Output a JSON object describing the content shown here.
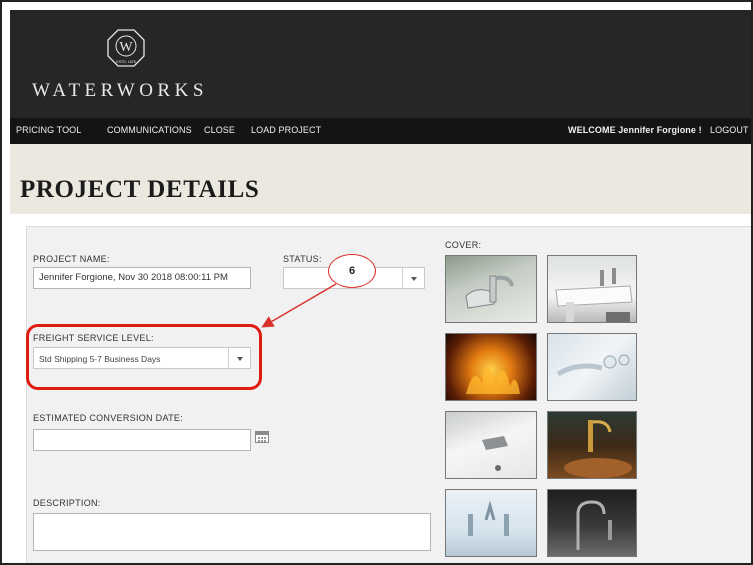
{
  "brand": {
    "estd": "ESTD. 1876",
    "monogram": "W",
    "name": "WATERWORKS",
    "icon": "octagon-monogram-logo"
  },
  "nav": {
    "items": [
      {
        "label": "PRICING TOOL"
      },
      {
        "label": "COMMUNICATIONS"
      },
      {
        "label": "CLOSE"
      },
      {
        "label": "LOAD PROJECT"
      }
    ],
    "welcome": "WELCOME Jennifer Forgione !",
    "logout": "LOGOUT"
  },
  "page": {
    "title": "PROJECT DETAILS"
  },
  "form": {
    "project_name_label": "PROJECT NAME:",
    "project_name_value": "Jennifer Forgione, Nov 30 2018 08:00:11 PM",
    "status_label": "STATUS:",
    "status_value": "",
    "freight_label": "FREIGHT SERVICE LEVEL:",
    "freight_value": "Std Shipping 5-7 Business Days",
    "conversion_label": "ESTIMATED CONVERSION DATE:",
    "conversion_value": "",
    "description_label": "DESCRIPTION:",
    "description_value": ""
  },
  "cover": {
    "label": "COVER:",
    "thumbs": [
      {
        "name": "chrome-faucet-photo"
      },
      {
        "name": "white-sink-faucet-photo"
      },
      {
        "name": "fireplace-photo"
      },
      {
        "name": "wall-mount-faucet-photo"
      },
      {
        "name": "white-basin-photo"
      },
      {
        "name": "brass-faucet-copper-sink-photo"
      },
      {
        "name": "cross-handle-faucet-photo"
      },
      {
        "name": "dark-kitchen-faucet-photo"
      }
    ]
  },
  "annotation": {
    "step_number": "6",
    "color": "#e01b12"
  },
  "colors": {
    "header_bg": "#262626",
    "nav_bg": "#141414",
    "title_band": "#ebe8df",
    "form_bg": "#f1f1f1"
  }
}
